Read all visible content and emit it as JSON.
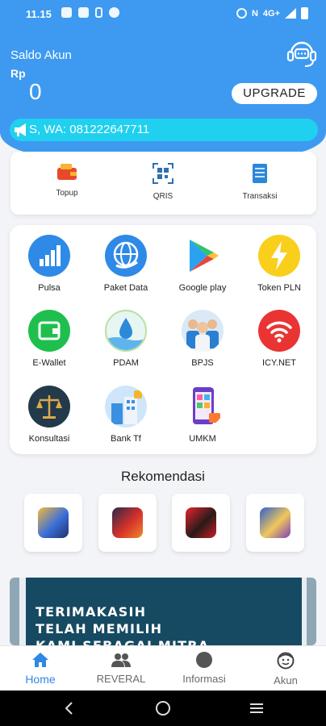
{
  "status_bar": {
    "time": "11.15",
    "network": "N",
    "signal": "4G+"
  },
  "header": {
    "saldo_label": "Saldo Akun",
    "currency": "Rp",
    "balance": "0",
    "upgrade_label": "UPGRADE",
    "marquee_text": "S, WA: 081222647711",
    "colors": {
      "header_bg": "#3d9af0",
      "marquee_bg": "#1fd0ef"
    }
  },
  "quick_actions": [
    {
      "label": "Topup",
      "icon": "wallet-icon"
    },
    {
      "label": "QRIS",
      "icon": "qr-scan-icon"
    },
    {
      "label": "Transaksi",
      "icon": "receipt-icon"
    }
  ],
  "services": [
    {
      "label": "Pulsa",
      "icon": "signal-bars-icon"
    },
    {
      "label": "Paket Data",
      "icon": "globe-icon"
    },
    {
      "label": "Google play",
      "icon": "google-play-icon"
    },
    {
      "label": "Token PLN",
      "icon": "lightning-icon"
    },
    {
      "label": "E-Wallet",
      "icon": "wallet-icon"
    },
    {
      "label": "PDAM",
      "icon": "water-drop-icon"
    },
    {
      "label": "BPJS",
      "icon": "medical-staff-icon"
    },
    {
      "label": "ICY.NET",
      "icon": "wifi-icon"
    },
    {
      "label": "Konsultasi",
      "icon": "scales-icon"
    },
    {
      "label": "Bank Tf",
      "icon": "bank-building-icon"
    },
    {
      "label": "UMKM",
      "icon": "shop-app-icon"
    }
  ],
  "recommendations": {
    "title": "Rekomendasi",
    "items": [
      {
        "icon": "game-thumbnail-icon"
      },
      {
        "icon": "game-thumbnail-icon"
      },
      {
        "icon": "game-thumbnail-icon"
      },
      {
        "icon": "game-thumbnail-icon"
      }
    ]
  },
  "banner": {
    "line1": "TERIMAKASIH",
    "line2": "TELAH MEMILIH",
    "line3": "KAMI SEBAGAI MITRA"
  },
  "bottom_nav": [
    {
      "label": "Home",
      "icon": "home-icon",
      "active": true
    },
    {
      "label": "REVERAL",
      "icon": "people-icon",
      "active": false
    },
    {
      "label": "Informasi",
      "icon": "info-circle-icon",
      "active": false
    },
    {
      "label": "Akun",
      "icon": "user-face-icon",
      "active": false
    }
  ]
}
